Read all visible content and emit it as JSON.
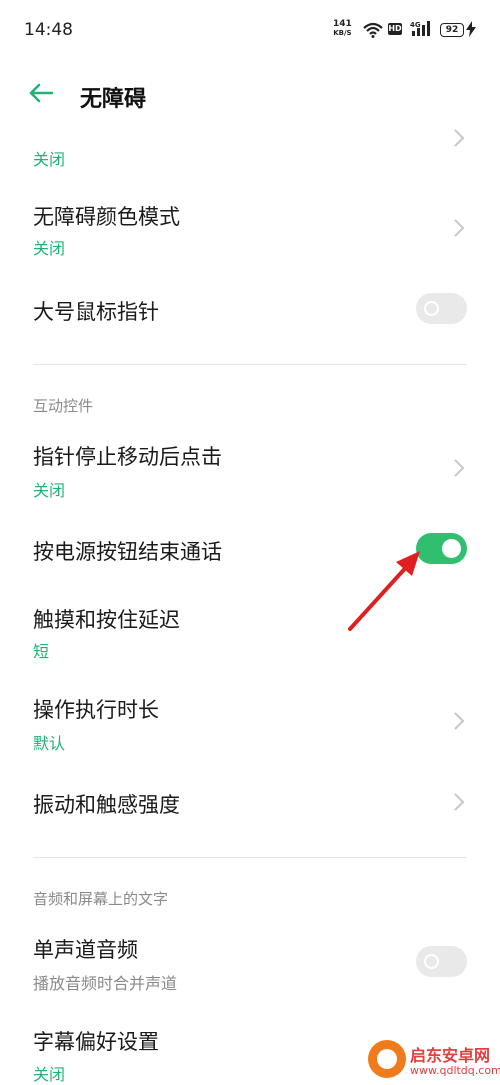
{
  "status_bar": {
    "time": "14:48",
    "net_speed": "141",
    "net_unit": "KB/S",
    "hd_badge": "HD",
    "network": "4G",
    "battery": "92"
  },
  "header": {
    "title": "无障碍"
  },
  "items": {
    "color_correction": {
      "subtitle": "关闭"
    },
    "color_mode": {
      "title": "无障碍颜色模式",
      "subtitle": "关闭"
    },
    "large_pointer": {
      "title": "大号鼠标指针",
      "toggle_on": false
    },
    "section_interaction": "互动控件",
    "click_after_stop": {
      "title": "指针停止移动后点击",
      "subtitle": "关闭"
    },
    "power_end_call": {
      "title": "按电源按钮结束通话",
      "toggle_on": true
    },
    "touch_hold_delay": {
      "title": "触摸和按住延迟",
      "subtitle": "短"
    },
    "action_time": {
      "title": "操作执行时长",
      "subtitle": "默认"
    },
    "vibration": {
      "title": "振动和触感强度"
    },
    "section_audio": "音频和屏幕上的文字",
    "mono_audio": {
      "title": "单声道音频",
      "subtitle": "播放音频时合并声道",
      "toggle_on": false
    },
    "captions": {
      "title": "字幕偏好设置",
      "subtitle": "关闭"
    }
  },
  "accent_color": "#2fbf6f",
  "annotation_arrow_color": "#e02020",
  "watermark": {
    "name": "启东安卓网",
    "url": "www.qdltdq.com"
  }
}
